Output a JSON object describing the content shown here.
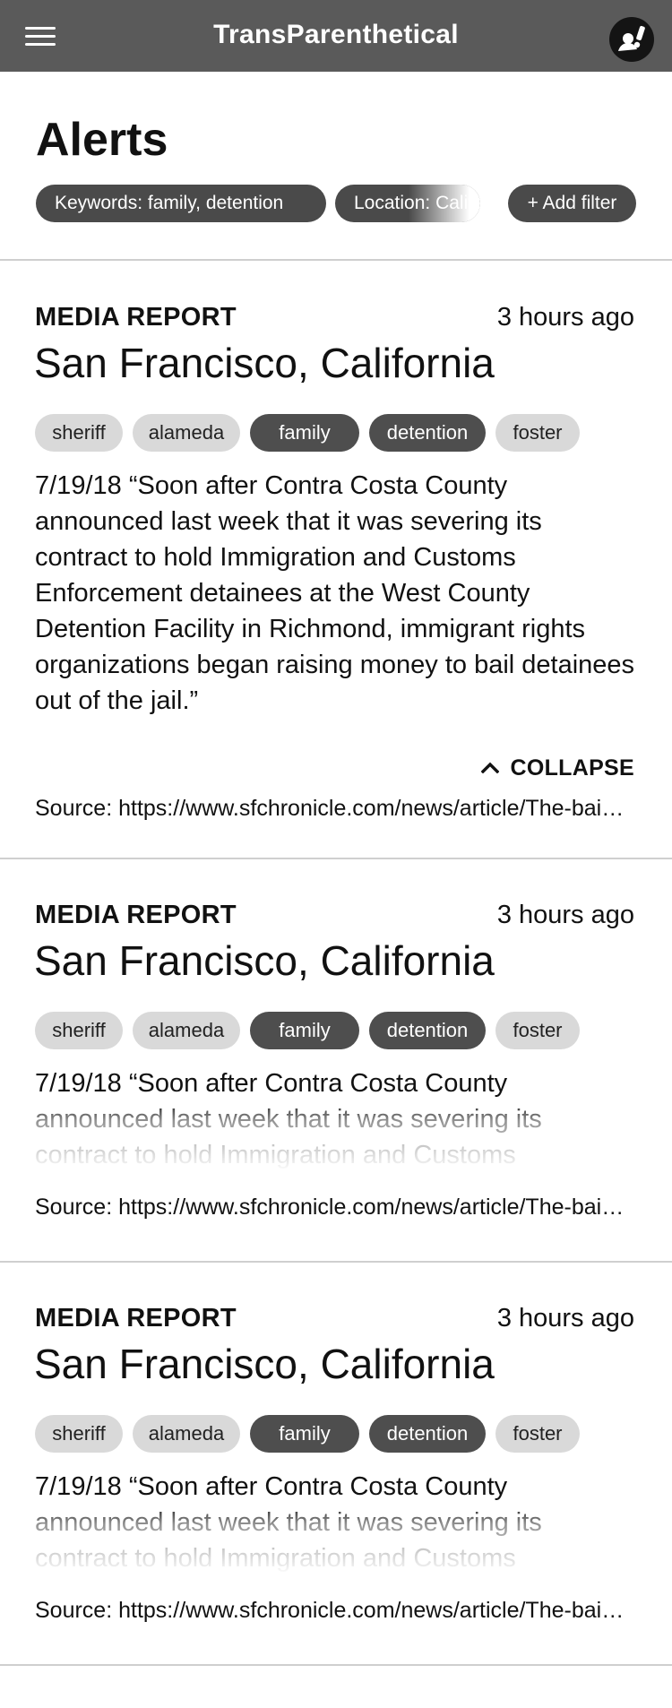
{
  "header": {
    "title": "TransParenthetical",
    "menu_icon": "hamburger-menu-icon",
    "account_icon": "user-alert-icon",
    "background_color": "#5a5a5a"
  },
  "page": {
    "title": "Alerts"
  },
  "filters": {
    "keywords": "Keywords: family, detention",
    "location": "Location: California",
    "add_filter": "+ Add filter"
  },
  "alerts": [
    {
      "type": "MEDIA REPORT",
      "time": "3 hours ago",
      "location": "San Francisco, California",
      "tags": [
        "sheriff",
        "alameda",
        "family",
        "detention",
        "foster"
      ],
      "body": "7/19/18 “Soon after Contra Costa County announced last week that it was severing its contract to hold Immigration and Customs Enforcement detainees at the West County Detention Facility in Richmond, immigrant rights organizations began raising money to bail detainees out of the jail.”",
      "expanded": true,
      "collapse_label": "COLLAPSE",
      "source": "Source: https://www.sfchronicle.com/news/article/The-bail-fund-immigrant-rights-groups-raise-money"
    },
    {
      "type": "MEDIA REPORT",
      "time": "3 hours ago",
      "location": "San Francisco, California",
      "tags": [
        "sheriff",
        "alameda",
        "family",
        "detention",
        "foster"
      ],
      "body": "7/19/18 “Soon after Contra Costa County announced last week that it was severing its contract to hold Immigration and Customs",
      "expanded": false,
      "source": "Source: https://www.sfchronicle.com/news/article/The-bail-fund-immigrant-rights-groups-raise-money"
    },
    {
      "type": "MEDIA REPORT",
      "time": "3 hours ago",
      "location": "San Francisco, California",
      "tags": [
        "sheriff",
        "alameda",
        "family",
        "detention",
        "foster"
      ],
      "body": "7/19/18 “Soon after Contra Costa County announced last week that it was severing its contract to hold Immigration and Customs",
      "expanded": false,
      "source": "Source: https://www.sfchronicle.com/news/article/The-bail-fund-immigrant-rights-groups-raise-money"
    }
  ]
}
